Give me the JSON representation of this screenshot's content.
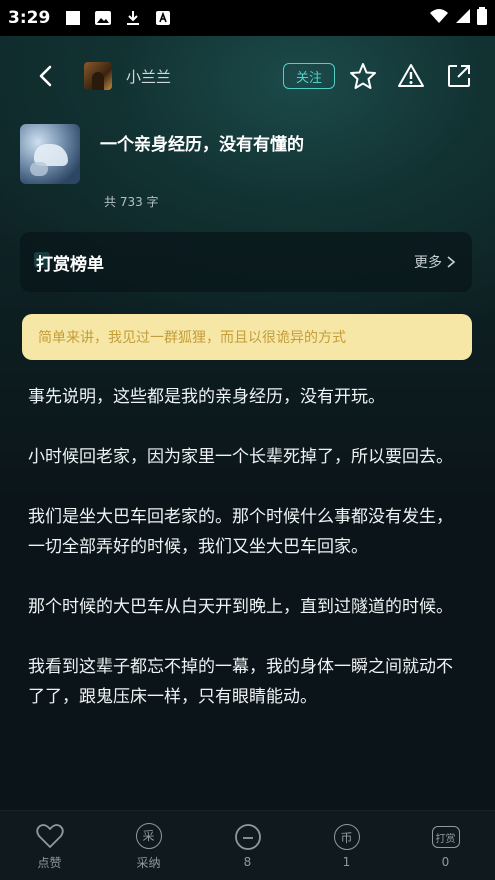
{
  "status_bar": {
    "time": "3:29"
  },
  "header": {
    "author_name": "小兰兰",
    "follow_label": "关注",
    "icons": [
      "back-icon",
      "star-icon",
      "warning-icon",
      "share-icon"
    ]
  },
  "article": {
    "title": "一个亲身经历，没有有懂的",
    "word_count": "共 733 字"
  },
  "reward": {
    "title": "打赏榜单",
    "more_label": "更多"
  },
  "summary": "简单来讲，我见过一群狐狸，而且以很诡异的方式",
  "paragraphs": [
    "事先说明，这些都是我的亲身经历，没有开玩。",
    "小时候回老家，因为家里一个长辈死掉了，所以要回去。",
    "我们是坐大巴车回老家的。那个时候什么事都没有发生，一切全部弄好的时候，我们又坐大巴车回家。",
    "那个时候的大巴车从白天开到晚上，直到过隧道的时候。",
    "我看到这辈子都忘不掉的一幕，我的身体一瞬之间就动不了了，跟鬼压床一样，只有眼睛能动。"
  ],
  "bottom_bar": {
    "like_label": "点赞",
    "adopt_glyph": "采",
    "adopt_label": "采纳",
    "comment_count": "8",
    "coin_glyph": "币",
    "coin_count": "1",
    "tip_glyph": "打赏",
    "tip_count": "0"
  },
  "colors": {
    "accent": "#52d0c8",
    "summary_bg": "#f7e7a6",
    "summary_text": "#c49d3a"
  }
}
